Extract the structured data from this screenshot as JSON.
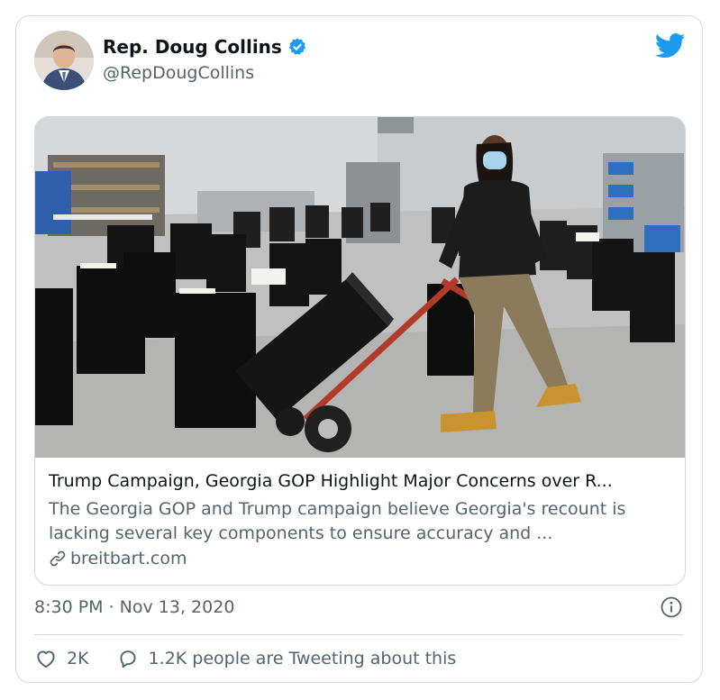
{
  "author": {
    "name": "Rep. Doug Collins",
    "handle": "@RepDougCollins",
    "verified": true
  },
  "brand_icon": "twitter-bird-icon",
  "link_card": {
    "title": "Trump Campaign, Georgia GOP Highlight Major Concerns over R...",
    "description": "The Georgia GOP and Trump campaign believe Georgia's recount is lacking several key components to ensure accuracy and ...",
    "domain": "breitbart.com"
  },
  "timestamp": "8:30 PM · Nov 13, 2020",
  "actions": {
    "likes": "2K",
    "tweeting": "1.2K people are Tweeting about this"
  },
  "colors": {
    "brand_blue": "#1d9bf0",
    "secondary_text": "#536471",
    "border": "#cfd9de"
  }
}
